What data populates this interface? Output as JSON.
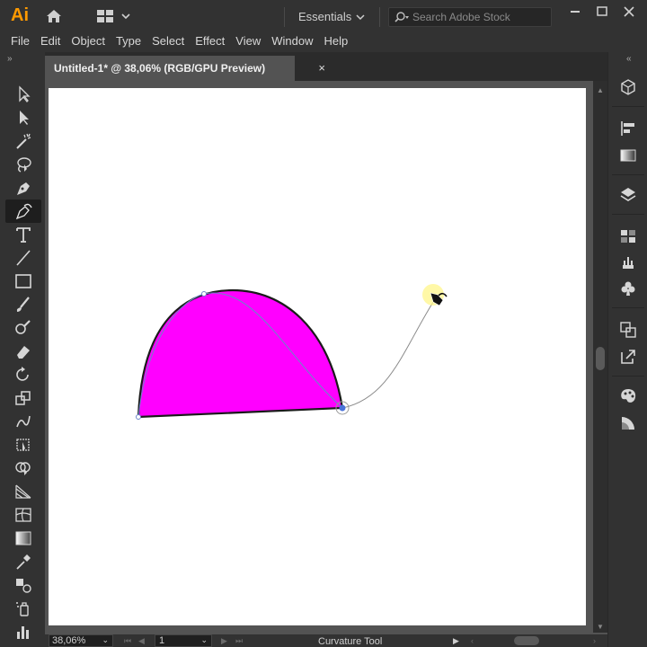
{
  "app": {
    "logo_text": "Ai",
    "workspace": "Essentials",
    "search_placeholder": "Search Adobe Stock"
  },
  "menu": [
    "File",
    "Edit",
    "Object",
    "Type",
    "Select",
    "Effect",
    "View",
    "Window",
    "Help"
  ],
  "document": {
    "tab_title": "Untitled-1* @ 38,06% (RGB/GPU Preview)",
    "close_glyph": "×"
  },
  "status": {
    "zoom": "38,06%",
    "page": "1",
    "active_tool": "Curvature Tool"
  },
  "tools": [
    "selection-tool",
    "direct-selection-tool",
    "magic-wand-tool",
    "lasso-tool",
    "pen-tool",
    "curvature-tool",
    "type-tool",
    "line-segment-tool",
    "rectangle-tool",
    "paintbrush-tool",
    "shaper-tool",
    "eraser-tool",
    "rotate-tool",
    "scale-tool",
    "warp-tool",
    "free-transform-tool",
    "shape-builder-tool",
    "perspective-grid-tool",
    "mesh-tool",
    "gradient-tool",
    "eyedropper-tool",
    "blend-tool",
    "symbol-sprayer-tool",
    "column-graph-tool"
  ],
  "colors": {
    "shape_fill": "#ff00ff",
    "path_stroke": "#1a1a1a",
    "guide_path": "#6b86c9",
    "accent": "#ff9a00"
  }
}
